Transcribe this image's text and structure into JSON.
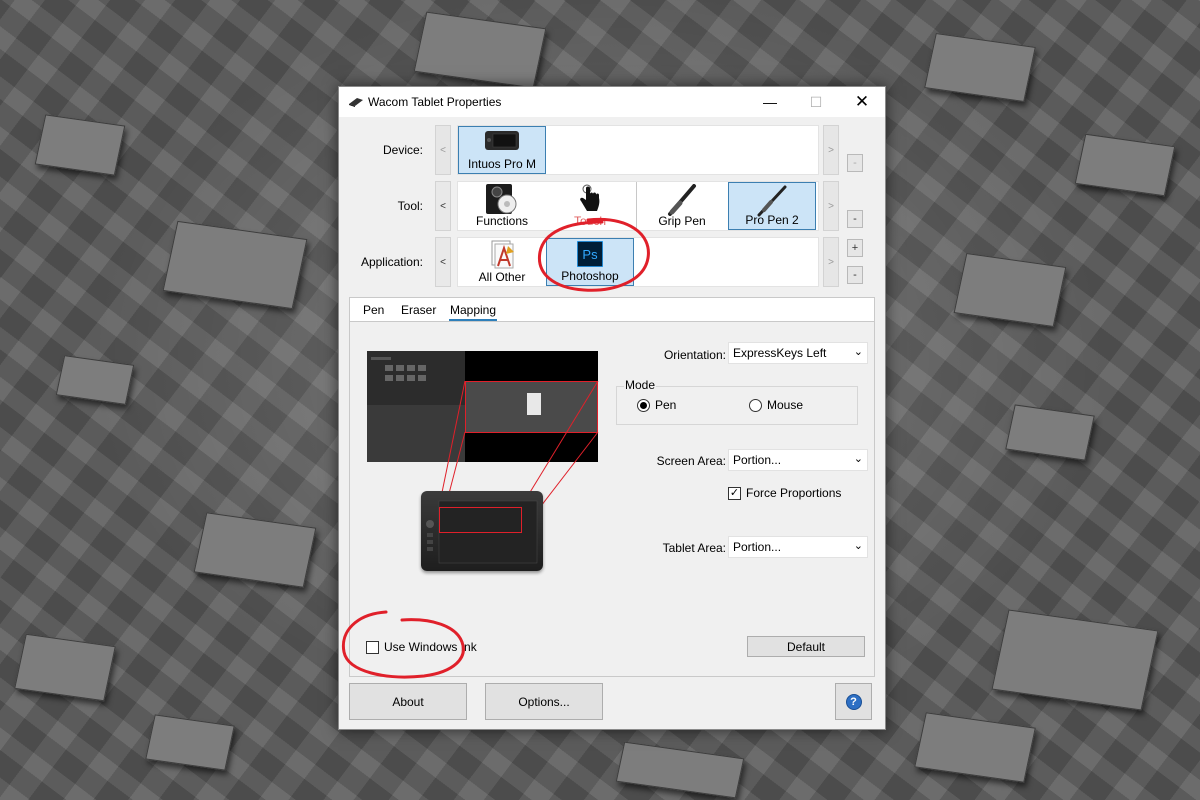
{
  "window": {
    "title": "Wacom Tablet Properties",
    "controls": {
      "minimize": "—",
      "maximize": "☐",
      "close": "✕"
    }
  },
  "device": {
    "label": "Device:",
    "items": [
      {
        "label": "Intuos Pro M",
        "selected": true
      }
    ],
    "prev": "<",
    "next": ">",
    "remove": "-"
  },
  "tool": {
    "label": "Tool:",
    "items": [
      {
        "label": "Functions",
        "selected": false
      },
      {
        "label": "Touch",
        "selected": false,
        "color": "#e06060"
      },
      {
        "label": "Grip Pen",
        "selected": false
      },
      {
        "label": "Pro Pen 2",
        "selected": true
      }
    ],
    "prev": "<",
    "next": ">",
    "remove": "-"
  },
  "application": {
    "label": "Application:",
    "items": [
      {
        "label": "All Other",
        "selected": false
      },
      {
        "label": "Photoshop",
        "selected": true
      }
    ],
    "prev": "<",
    "next": ">",
    "add": "+",
    "remove": "-"
  },
  "tabs": [
    {
      "label": "Pen",
      "active": false
    },
    {
      "label": "Eraser",
      "active": false
    },
    {
      "label": "Mapping",
      "active": true
    }
  ],
  "mapping": {
    "orientation": {
      "label": "Orientation:",
      "value": "ExpressKeys Left"
    },
    "mode": {
      "label": "Mode",
      "options": [
        {
          "label": "Pen",
          "selected": true
        },
        {
          "label": "Mouse",
          "selected": false
        }
      ]
    },
    "screen_area": {
      "label": "Screen Area:",
      "value": "Portion..."
    },
    "force_proportions": {
      "label": "Force Proportions",
      "checked": true
    },
    "tablet_area": {
      "label": "Tablet Area:",
      "value": "Portion..."
    },
    "use_windows_ink": {
      "label": "Use Windows Ink",
      "checked": false
    },
    "default_button": "Default"
  },
  "footer": {
    "about": "About",
    "options": "Options...",
    "help": "?"
  },
  "colors": {
    "selection": "#cce4f7",
    "selection_border": "#3c7fb1",
    "annotation": "#e0202a",
    "tab_accent": "#2e7fba",
    "photoshop_blue": "#31a8ff"
  }
}
